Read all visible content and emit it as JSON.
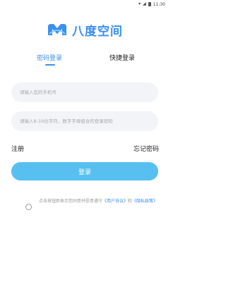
{
  "status_bar": {
    "time": "11:30"
  },
  "logo": {
    "text": "八度空间"
  },
  "tabs": [
    {
      "label": "密码登录"
    },
    {
      "label": "快捷登录"
    }
  ],
  "form": {
    "phone_placeholder": "请输入您的手机号",
    "password_placeholder": "请输入8-16位字符，数字字母组合的登录密码",
    "register_label": "注册",
    "forgot_label": "忘记密码",
    "login_label": "登录"
  },
  "agreement": {
    "prefix": "点击按钮即表示您同意并愿意遵守",
    "user_agreement": "《用户协议》",
    "conjunction": "和",
    "privacy_policy": "《隐私政策》"
  },
  "colors": {
    "accent": "#3b8ff0",
    "button": "#57c0f0",
    "input_bg": "#f3f4f7"
  }
}
